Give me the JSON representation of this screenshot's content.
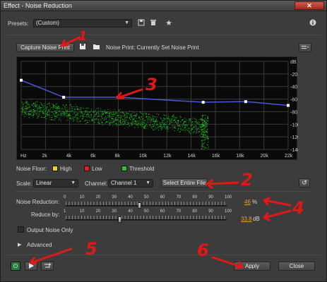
{
  "window": {
    "title": "Effect - Noise Reduction",
    "close_label": "✕"
  },
  "presets": {
    "label": "Presets:",
    "value": "(Custom)"
  },
  "noise_print": {
    "capture_label": "Capture Noise Print",
    "status_label": "Noise Print: Currently Set Noise Print"
  },
  "graph": {
    "db_labels": [
      "dB",
      "-20",
      "-40",
      "-60",
      "-80",
      "-100",
      "-120",
      "-140"
    ],
    "hz_labels": [
      "Hz",
      "2k",
      "4k",
      "6k",
      "8k",
      "10k",
      "12k",
      "14k",
      "16k",
      "18k",
      "20k",
      "22k"
    ],
    "threshold_points_db": [
      [
        0,
        -30
      ],
      [
        3500,
        -57
      ],
      [
        8000,
        -57
      ],
      [
        15000,
        -65
      ],
      [
        18500,
        -64
      ],
      [
        22000,
        -70
      ]
    ],
    "colors": {
      "curve": "#4a58d8",
      "noise": "#22cc22",
      "high": "#f0d020",
      "low": "#e02020",
      "threshold": "#30c030"
    }
  },
  "legend": {
    "title": "Noise Floor:",
    "high": "High",
    "low": "Low",
    "threshold": "Threshold"
  },
  "scale": {
    "label": "Scale:",
    "value": "Linear"
  },
  "channel": {
    "label": "Channel:",
    "value": "Channel 1"
  },
  "select_entire_file_label": "Select Entire File",
  "noise_reduction": {
    "label": "Noise Reduction:",
    "ticks": [
      "0",
      "10",
      "20",
      "30",
      "40",
      "50",
      "60",
      "70",
      "80",
      "90",
      "100"
    ],
    "value": "46",
    "unit": "%",
    "level": 0.46
  },
  "reduce_by": {
    "label": "Reduce by:",
    "ticks": [
      "1",
      "10",
      "20",
      "30",
      "40",
      "50",
      "60",
      "70",
      "80",
      "90",
      "100"
    ],
    "value": "33.8",
    "unit": "dB",
    "level": 0.338
  },
  "output_noise_only_label": "Output Noise Only",
  "advanced_label": "Advanced",
  "footer": {
    "apply_label": "Apply",
    "close_label": "Close"
  },
  "annotations": [
    "1",
    "2",
    "3",
    "4",
    "5",
    "6"
  ]
}
